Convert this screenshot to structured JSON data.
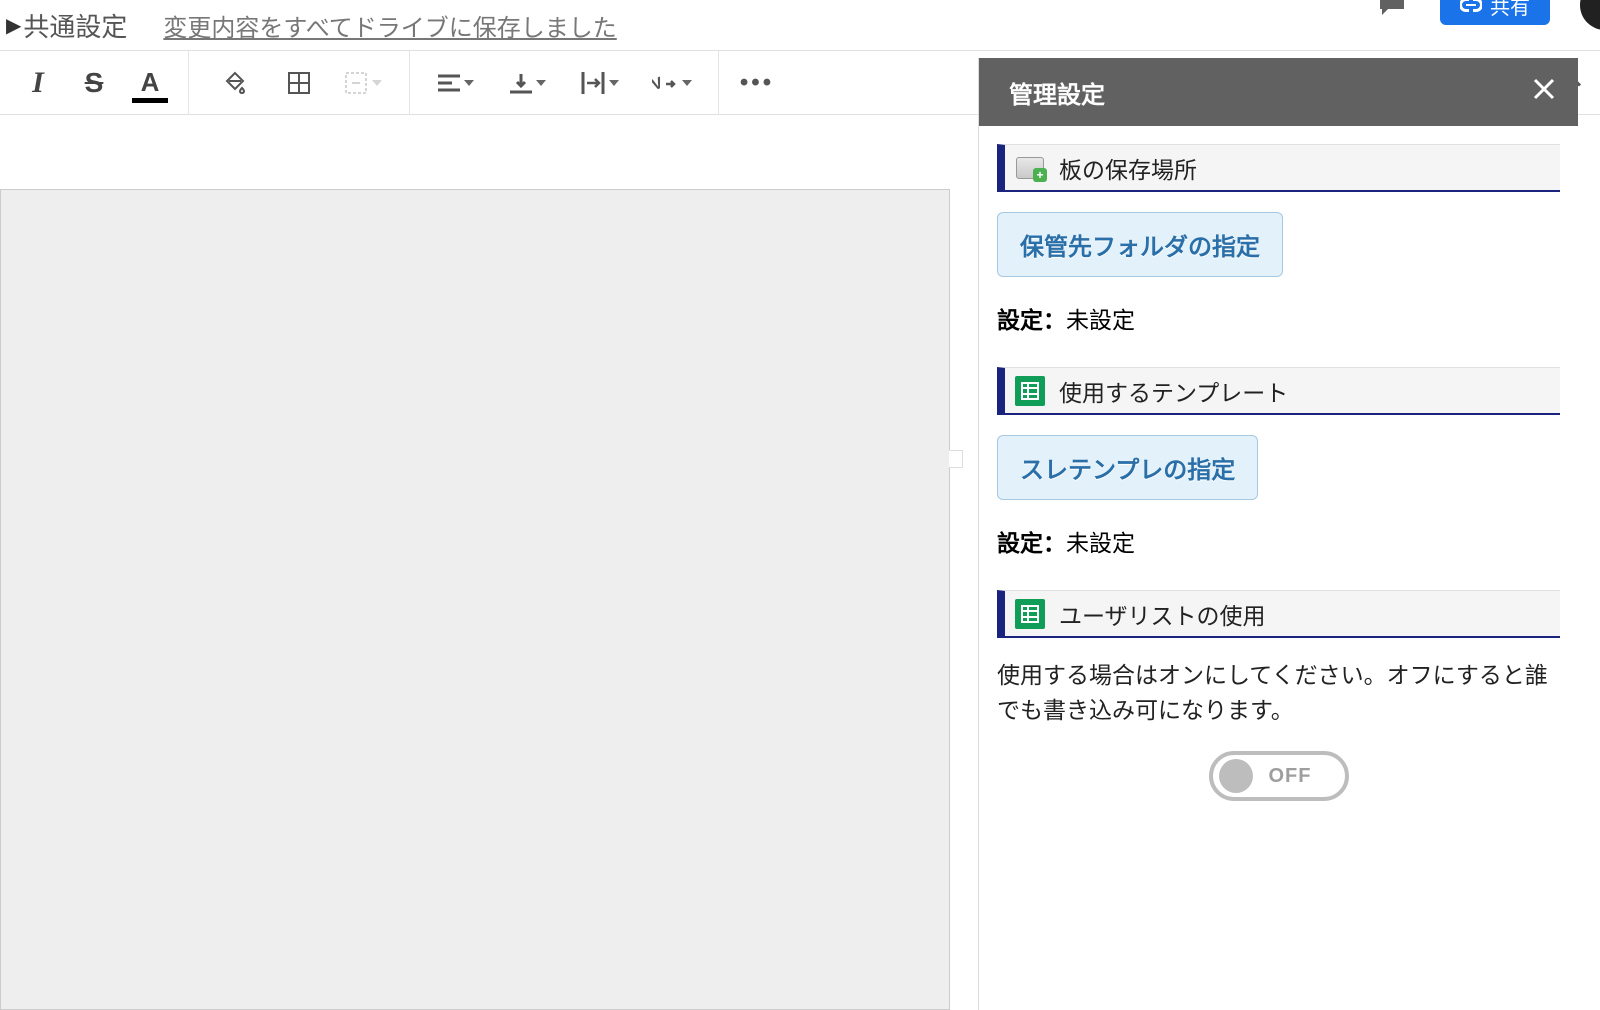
{
  "header": {
    "doc_title": "共通設定",
    "save_status": "変更内容をすべてドライブに保存しました",
    "share_button": "共有"
  },
  "toolbar": {
    "italic": "I",
    "strike": "S",
    "text_color": "A",
    "more": "•••"
  },
  "sidebar": {
    "title": "管理設定",
    "section1": {
      "title": "板の保存場所",
      "button": "保管先フォルダの指定",
      "status_label": "設定：",
      "status_value": "未設定"
    },
    "section2": {
      "title": "使用するテンプレート",
      "button": "スレテンプレの指定",
      "status_label": "設定：",
      "status_value": "未設定"
    },
    "section3": {
      "title": "ユーザリストの使用",
      "help": "使用する場合はオンにしてください。オフにすると誰でも書き込み可になります。",
      "toggle_state": "OFF"
    }
  }
}
